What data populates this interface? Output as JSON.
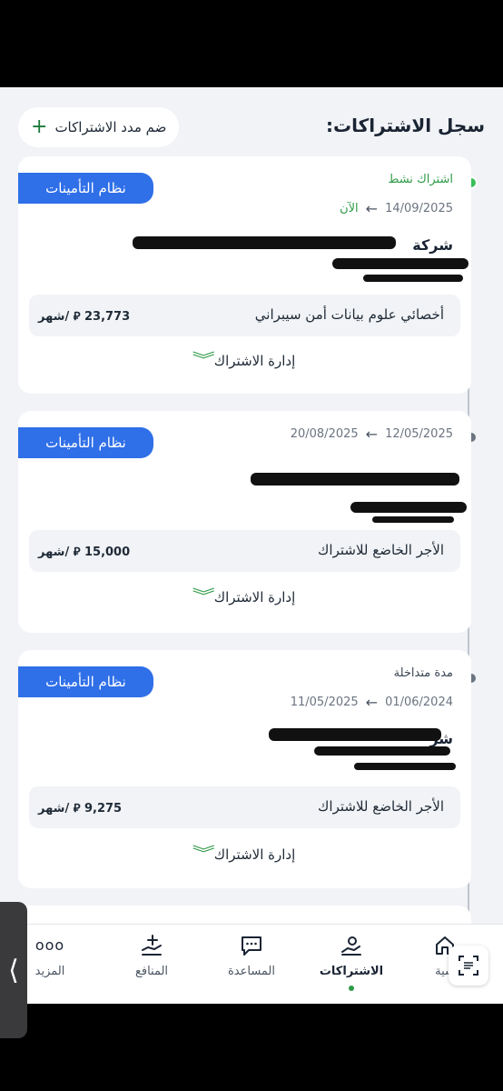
{
  "header": {
    "title": "سجل الاشتراكات:",
    "add_button_label": "ضم مدد الاشتراكات",
    "add_icon": "plus-icon"
  },
  "subscriptions": [
    {
      "badge": "نظام التأمينات",
      "status": "اشتراك نشط",
      "start_date": "14/09/2025",
      "end_date": "الآن",
      "company": "شركة",
      "job": "أخصائي علوم بيانات أمن سيبراني",
      "salary": "23,773 ⃁ /شهر",
      "manage_label": "إدارة الاشتراك"
    },
    {
      "badge": "نظام التأمينات",
      "status": "",
      "start_date": "12/05/2025",
      "end_date": "20/08/2025",
      "company": "",
      "job": "الأجر الخاضع للاشتراك",
      "salary": "15,000 ⃁ /شهر",
      "manage_label": "إدارة الاشتراك"
    },
    {
      "badge": "نظام التأمينات",
      "status": "مدة متداخلة",
      "start_date": "01/06/2024",
      "end_date": "11/05/2025",
      "company": "شر",
      "job": "الأجر الخاضع للاشتراك",
      "salary": "9,275 ⃁ /شهر",
      "manage_label": "إدارة الاشتراك"
    }
  ],
  "nav": {
    "items": [
      {
        "label": "سية",
        "icon": "home-icon"
      },
      {
        "label": "الاشتراكات",
        "icon": "subscriptions-icon"
      },
      {
        "label": "المساعدة",
        "icon": "chat-icon"
      },
      {
        "label": "المنافع",
        "icon": "benefits-icon"
      },
      {
        "label": "المزيد",
        "icon": "more-icon"
      }
    ],
    "more_glyph": "ooo"
  },
  "colors": {
    "accent_blue": "#2f6fe8",
    "active_green": "#2e9a46",
    "background": "#f1f3f6"
  }
}
